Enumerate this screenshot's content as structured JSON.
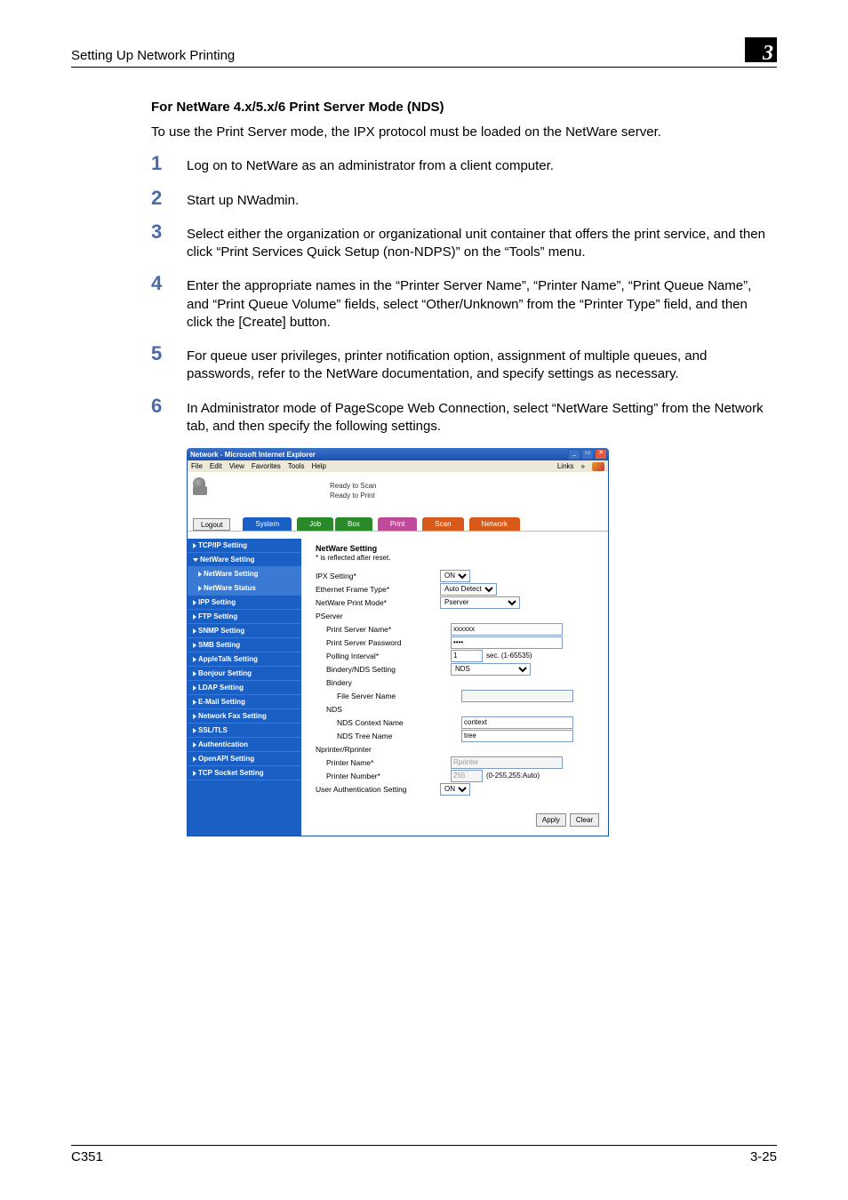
{
  "header": {
    "running_title": "Setting Up Network Printing",
    "chapter_number": "3"
  },
  "section": {
    "title": "For NetWare 4.x/5.x/6 Print Server Mode (NDS)",
    "intro": "To use the Print Server mode, the IPX protocol must be loaded on the NetWare server.",
    "steps": [
      "Log on to NetWare as an administrator from a client computer.",
      "Start up NWadmin.",
      "Select either the organization or organizational unit container that offers the print service, and then click “Print Services Quick Setup (non-NDPS)” on the “Tools” menu.",
      "Enter the appropriate names in the “Printer Server Name”, “Printer Name”, “Print Queue Name”, and “Print Queue Volume” fields, select “Other/Unknown” from the “Printer Type” field, and then click the [Create] button.",
      "For queue user privileges, printer notification option, assignment of multiple queues, and passwords, refer to the NetWare documentation, and specify settings as necessary.",
      "In Administrator mode of PageScope Web Connection, select “NetWare Setting” from the Network tab, and then specify the following settings."
    ]
  },
  "screenshot": {
    "window_title": "Network - Microsoft Internet Explorer",
    "menu": {
      "items": [
        "File",
        "Edit",
        "View",
        "Favorites",
        "Tools",
        "Help"
      ],
      "links_label": "Links"
    },
    "status": {
      "line1": "Ready to Scan",
      "line2": "Ready to Print"
    },
    "logout_button": "Logout",
    "tabs": [
      "System",
      "Job",
      "Box",
      "Print",
      "Scan",
      "Network"
    ],
    "sidebar": [
      {
        "label": "TCP/IP Setting",
        "type": "item"
      },
      {
        "label": "NetWare Setting",
        "type": "open"
      },
      {
        "label": "NetWare Setting",
        "type": "sub"
      },
      {
        "label": "NetWare Status",
        "type": "sub"
      },
      {
        "label": "IPP Setting",
        "type": "item"
      },
      {
        "label": "FTP Setting",
        "type": "item"
      },
      {
        "label": "SNMP Setting",
        "type": "item"
      },
      {
        "label": "SMB Setting",
        "type": "item"
      },
      {
        "label": "AppleTalk Setting",
        "type": "item"
      },
      {
        "label": "Bonjour Setting",
        "type": "item"
      },
      {
        "label": "LDAP Setting",
        "type": "item"
      },
      {
        "label": "E-Mail Setting",
        "type": "item"
      },
      {
        "label": "Network Fax Setting",
        "type": "item"
      },
      {
        "label": "SSL/TLS",
        "type": "item"
      },
      {
        "label": "Authentication",
        "type": "item"
      },
      {
        "label": "OpenAPI Setting",
        "type": "item"
      },
      {
        "label": "TCP Socket Setting",
        "type": "item"
      }
    ],
    "panel": {
      "title": "NetWare Setting",
      "note": "* is reflected after reset.",
      "labels": {
        "ipx": "IPX Setting*",
        "frame": "Ethernet Frame Type*",
        "mode": "NetWare Print Mode*",
        "pserver": "PServer",
        "psname": "Print Server Name*",
        "pspass": "Print Server Password",
        "polling": "Polling Interval*",
        "bindery": "Bindery/NDS Setting",
        "bindery_sub": "Bindery",
        "fserver": "File Server Name",
        "nds": "NDS",
        "ndscontext": "NDS Context Name",
        "ndstree": "NDS Tree Name",
        "nprinter": "Nprinter/Rprinter",
        "prname": "Printer Name*",
        "prnum": "Printer Number*",
        "userauth": "User Authentication Setting"
      },
      "values": {
        "ipx": "ON",
        "frame": "Auto Detect",
        "mode": "Pserver",
        "psname": "xxxxxx",
        "pspass": "••••",
        "polling": "1",
        "polling_range": "sec. (1-65535)",
        "bindery": "NDS",
        "fserver": "",
        "ndscontext": "context",
        "ndstree": "tree",
        "prname": "Rprinter",
        "prnum": "255",
        "prnum_range": "(0-255,255:Auto)",
        "userauth": "ON"
      },
      "buttons": {
        "apply": "Apply",
        "clear": "Clear"
      }
    }
  },
  "footer": {
    "left": "C351",
    "right": "3-25"
  }
}
